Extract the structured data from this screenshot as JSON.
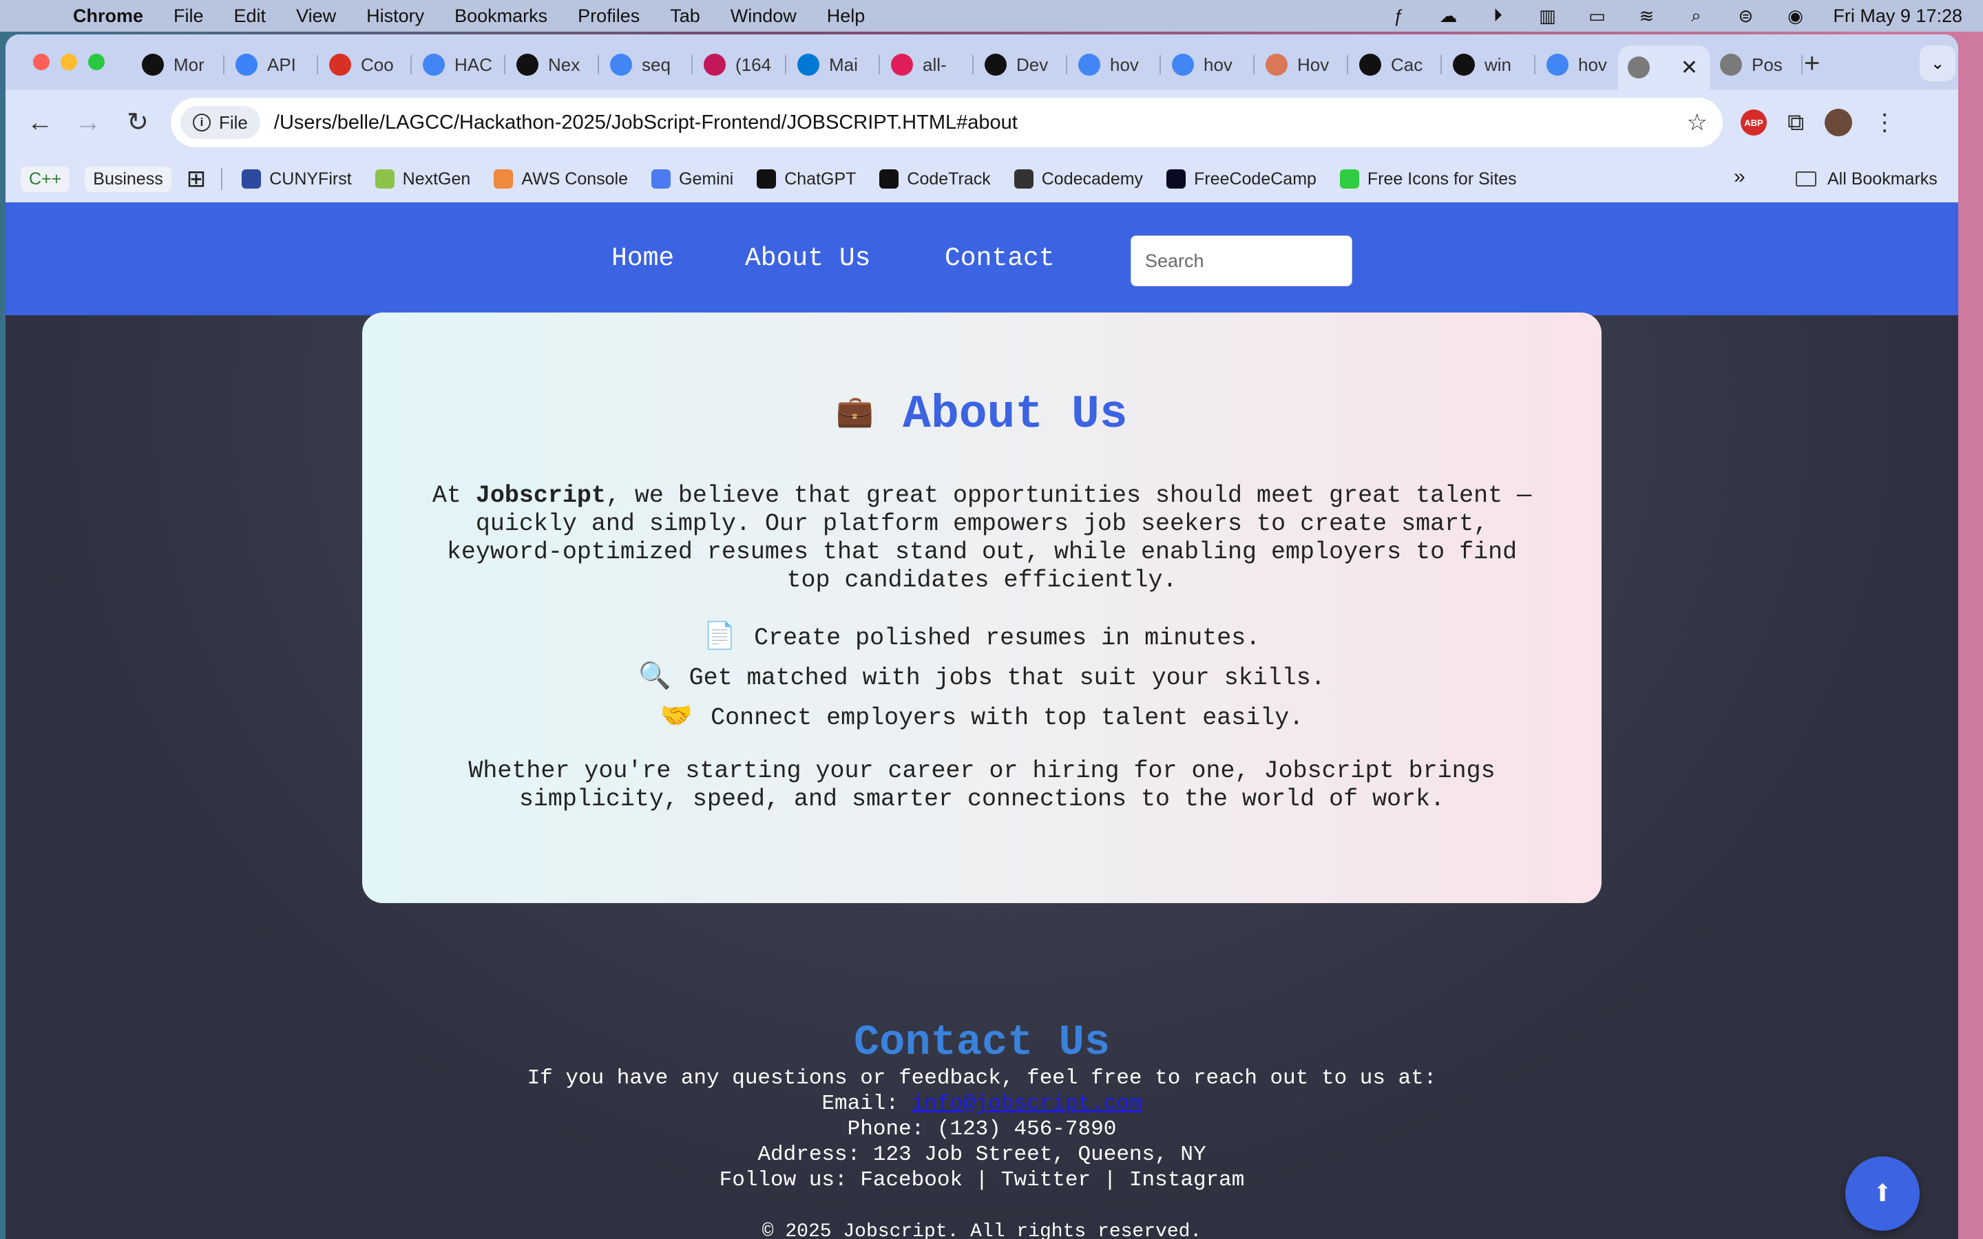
{
  "menubar": {
    "app": "Chrome",
    "items": [
      "File",
      "Edit",
      "View",
      "History",
      "Bookmarks",
      "Profiles",
      "Tab",
      "Window",
      "Help"
    ],
    "clock": "Fri May 9  17:28"
  },
  "tabs": [
    {
      "label": "Mor",
      "color": "#111"
    },
    {
      "label": "API",
      "color": "#3b82f6"
    },
    {
      "label": "Coo",
      "color": "#d93025"
    },
    {
      "label": "HAC",
      "color": "#4285f4"
    },
    {
      "label": "Nex",
      "color": "#111"
    },
    {
      "label": "seq",
      "color": "#4285f4"
    },
    {
      "label": "(164",
      "color": "#c2185b"
    },
    {
      "label": "Mai",
      "color": "#0078d4"
    },
    {
      "label": "all-",
      "color": "#e01e5a"
    },
    {
      "label": "Dev",
      "color": "#111"
    },
    {
      "label": "hov",
      "color": "#4285f4"
    },
    {
      "label": "hov",
      "color": "#4285f4"
    },
    {
      "label": "Hov",
      "color": "#d97757"
    },
    {
      "label": "Cac",
      "color": "#111"
    },
    {
      "label": "win",
      "color": "#111"
    },
    {
      "label": "hov",
      "color": "#4285f4"
    },
    {
      "label": "",
      "color": "#7a7a7a"
    },
    {
      "label": "Pos",
      "color": "#7a7a7a"
    }
  ],
  "toolbar": {
    "chip": "File",
    "url": "/Users/belle/LAGCC/Hackathon-2025/JobScript-Frontend/JOBSCRIPT.HTML#about",
    "abp": "ABP"
  },
  "bookmarks": {
    "pills": [
      "C++",
      "Business"
    ],
    "items": [
      {
        "label": "CUNYFirst",
        "color": "#2b4aa0"
      },
      {
        "label": "NextGen",
        "color": "#8bc34a"
      },
      {
        "label": "AWS Console",
        "color": "#f0883e"
      },
      {
        "label": "Gemini",
        "color": "#4a7bf0"
      },
      {
        "label": "ChatGPT",
        "color": "#111"
      },
      {
        "label": "CodeTrack",
        "color": "#111"
      },
      {
        "label": "Codecademy",
        "color": "#333"
      },
      {
        "label": "FreeCodeCamp",
        "color": "#0a0a23"
      },
      {
        "label": "Free Icons for Sites",
        "color": "#2ecc40"
      }
    ],
    "more": "»",
    "all": "All Bookmarks"
  },
  "site": {
    "nav": [
      "Home",
      "About Us",
      "Contact"
    ],
    "search_placeholder": "Search",
    "about": {
      "title": "About Us",
      "intro_prefix": "At ",
      "brand": "Jobscript",
      "intro_rest": ", we believe that great opportunities should meet great talent — quickly and simply. Our platform empowers job seekers to create smart, keyword-optimized resumes that stand out, while enabling employers to find top candidates efficiently.",
      "features": [
        {
          "icon": "📄",
          "icon_name": "document-icon",
          "text": "Create polished resumes in minutes."
        },
        {
          "icon": "🔍",
          "icon_name": "magnifier-icon",
          "text": "Get matched with jobs that suit your skills."
        },
        {
          "icon": "🤝",
          "icon_name": "handshake-icon",
          "text": "Connect employers with top talent easily."
        }
      ],
      "closing": "Whether you're starting your career or hiring for one, Jobscript brings simplicity, speed, and smarter connections to the world of work."
    },
    "contact": {
      "title": "Contact Us",
      "intro": "If you have any questions or feedback, feel free to reach out to us at:",
      "email_label": "Email: ",
      "email": "info@jobscript.com",
      "phone": "Phone: (123) 456-7890",
      "address": "Address: 123 Job Street, Queens, NY",
      "follow_label": "Follow us: ",
      "social": [
        "Facebook",
        "Twitter",
        "Instagram"
      ]
    },
    "copyright": "© 2025 Jobscript. All rights reserved.",
    "accent": "#3b63e2"
  }
}
